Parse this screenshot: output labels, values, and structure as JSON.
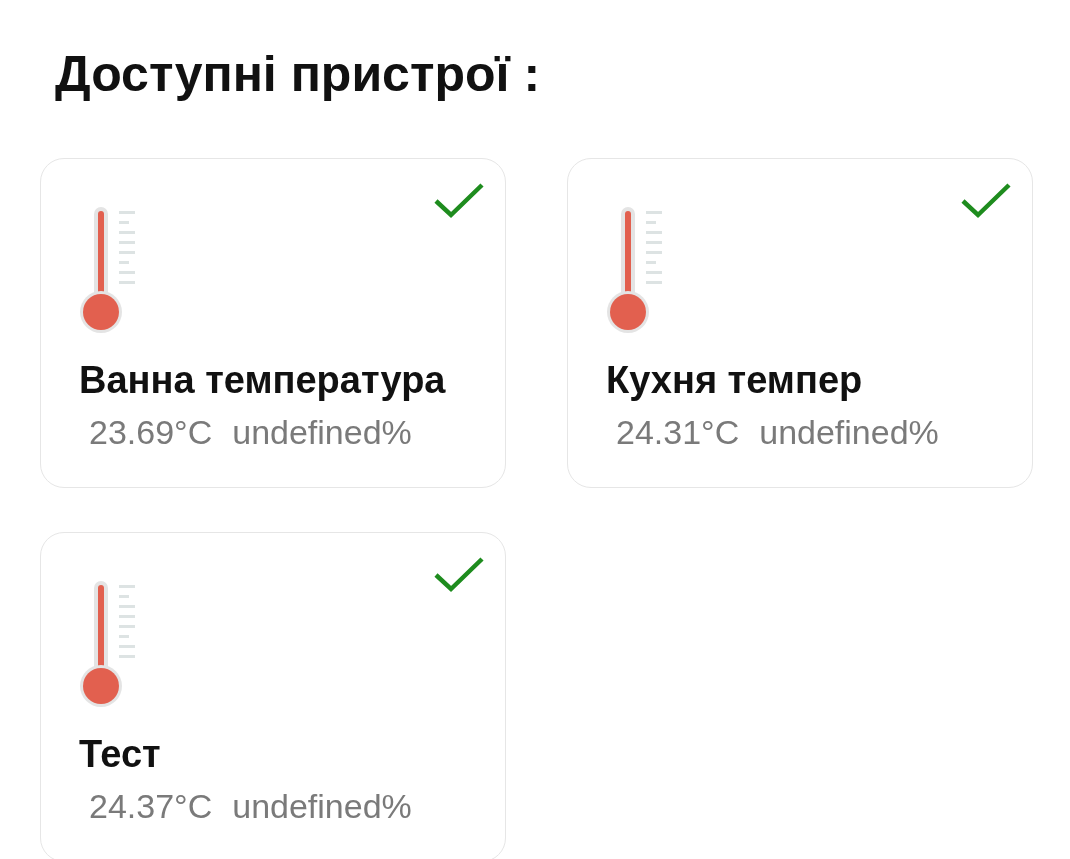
{
  "title": "Доступні пристрої :",
  "devices": [
    {
      "name": "Ванна температура",
      "temperature": "23.69°C",
      "humidity": "undefined%",
      "online": true
    },
    {
      "name": "Кухня темпер",
      "temperature": "24.31°C",
      "humidity": "undefined%",
      "online": true
    },
    {
      "name": "Тест",
      "temperature": "24.37°C",
      "humidity": "undefined%",
      "online": true
    }
  ]
}
